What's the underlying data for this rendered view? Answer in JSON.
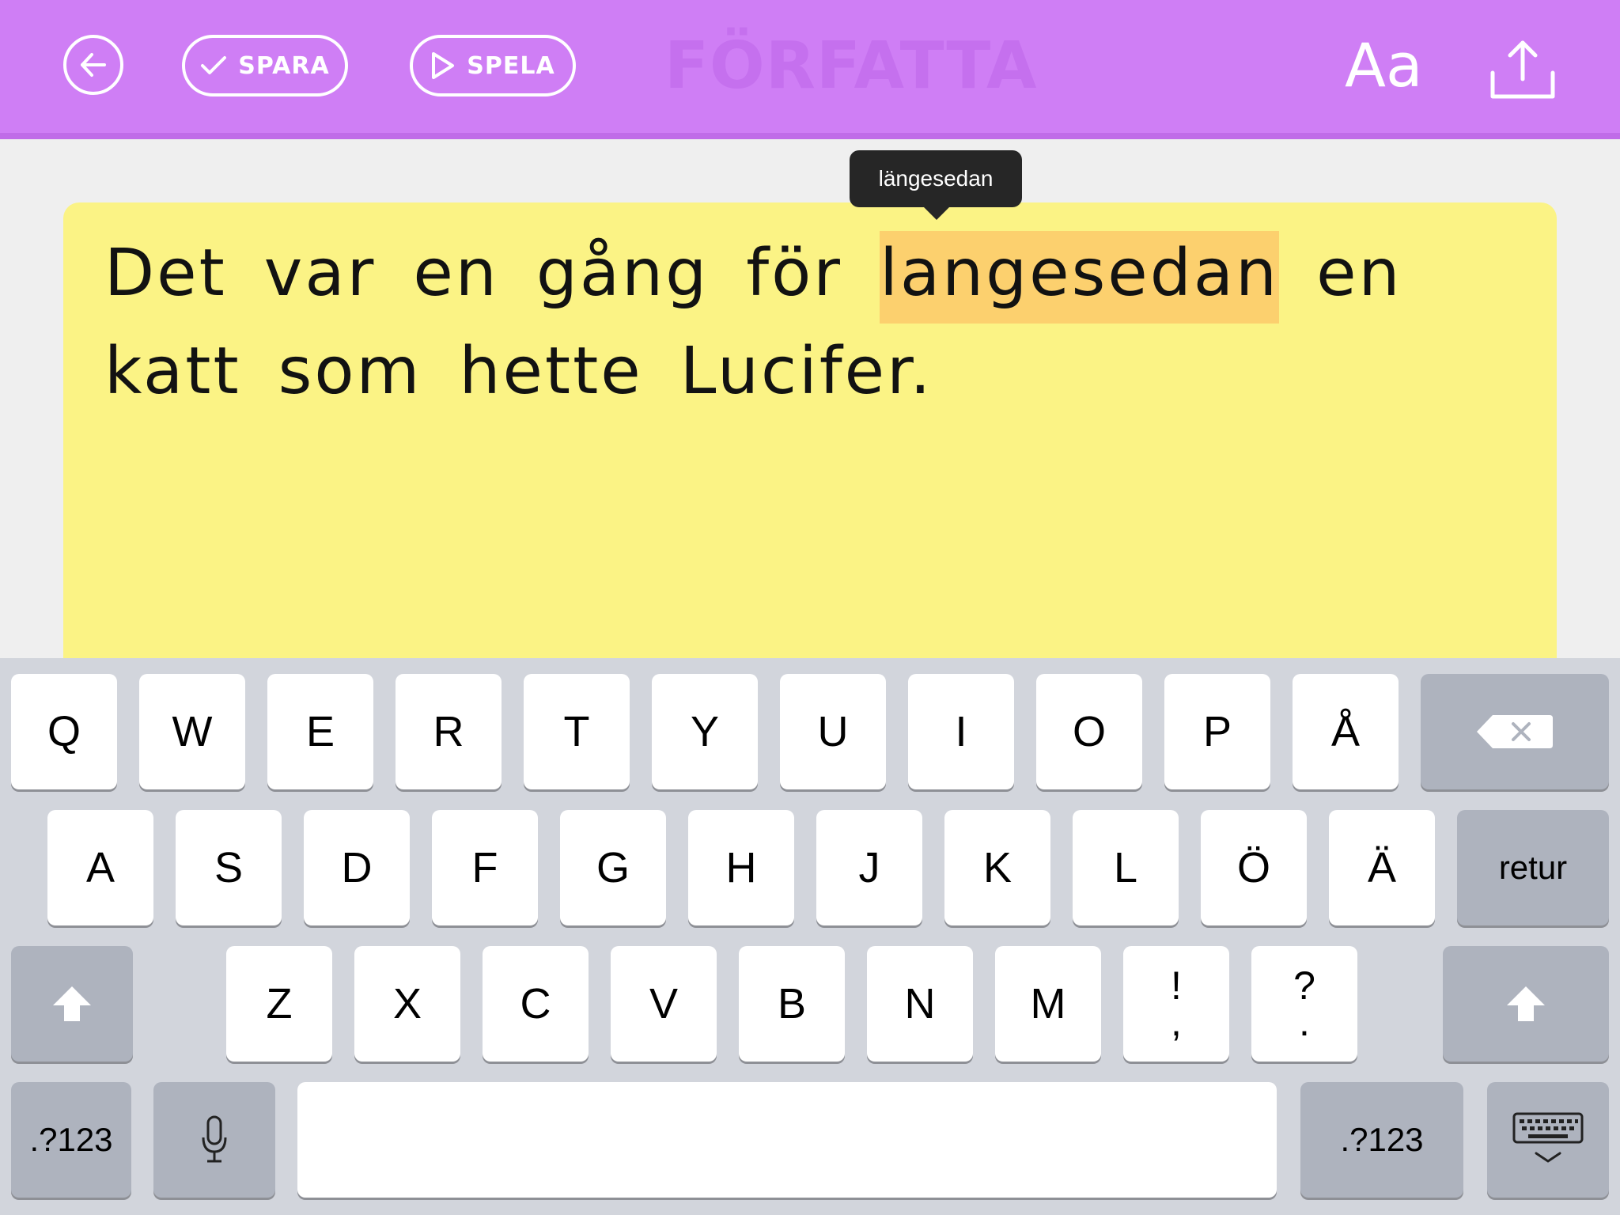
{
  "header": {
    "back_icon": "arrow-left-icon",
    "save_label": "SPARA",
    "play_label": "SPELA",
    "title": "FÖRFATTA",
    "font_label": "Aa",
    "share_icon": "share-upload-icon"
  },
  "editor": {
    "text_before": "Det var en gång för ",
    "highlighted_word": "langesedan",
    "text_after": " en katt som hette Lucifer.",
    "suggestion": "längesedan"
  },
  "colors": {
    "header": "#cf7ef5",
    "card": "#fbf385",
    "highlight": "#fcd06e",
    "keyboard": "#d2d5dc"
  },
  "keyboard": {
    "row1": [
      "Q",
      "W",
      "E",
      "R",
      "T",
      "Y",
      "U",
      "I",
      "O",
      "P",
      "Å"
    ],
    "row2": [
      "A",
      "S",
      "D",
      "F",
      "G",
      "H",
      "J",
      "K",
      "L",
      "Ö",
      "Ä"
    ],
    "row3": [
      "Z",
      "X",
      "C",
      "V",
      "B",
      "N",
      "M"
    ],
    "punct1_top": "!",
    "punct1_bottom": ",",
    "punct2_top": "?",
    "punct2_bottom": ".",
    "return_label": "retur",
    "numbers_label": ".?123",
    "backspace_icon": "backspace-icon",
    "shift_icon": "shift-icon",
    "mic_icon": "microphone-icon",
    "dismiss_icon": "keyboard-dismiss-icon"
  }
}
